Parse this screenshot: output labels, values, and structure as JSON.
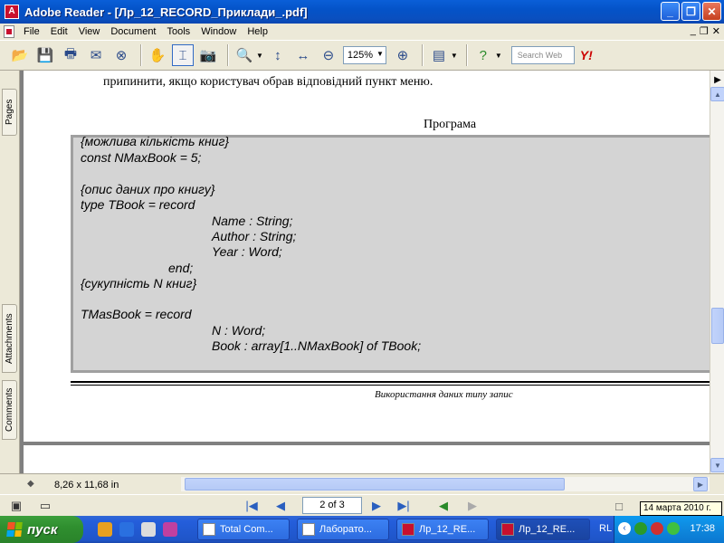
{
  "window": {
    "title": "Adobe Reader - [Лр_12_RECORD_Приклади_.pdf]"
  },
  "menu": [
    "File",
    "Edit",
    "View",
    "Document",
    "Tools",
    "Window",
    "Help"
  ],
  "toolbar": {
    "zoom": "125%",
    "search_placeholder": "Search Web"
  },
  "side_tabs": [
    "Pages",
    "Attachments",
    "Comments"
  ],
  "document": {
    "paragraph_tail": "припинити, якщо користувач обрав відповідний пункт меню.",
    "heading": "Програма",
    "code_lines": [
      "{можлива кількість книг}",
      "const NMaxBook = 5;",
      "",
      "{опис даних про книгу}",
      "type TBook = record",
      "Name : String;",
      "Author : String;",
      "Year : Word;",
      "end;",
      "{сукупність N книг}",
      "",
      "TMasBook = record",
      "N : Word;",
      "Book : array[1..NMaxBook] of TBook;"
    ],
    "caption": "Використання даних типу запис"
  },
  "status": {
    "page_size": "8,26 x 11,68 in"
  },
  "navigation": {
    "page_display": "2 of 3"
  },
  "tooltip": "14 марта 2010 г.",
  "taskbar": {
    "start_label": "пуск",
    "tasks": [
      "Total Com...",
      "Лаборато...",
      "Лр_12_RE...",
      "Лр_12_RE..."
    ],
    "language": "RL",
    "clock": "17:38"
  }
}
